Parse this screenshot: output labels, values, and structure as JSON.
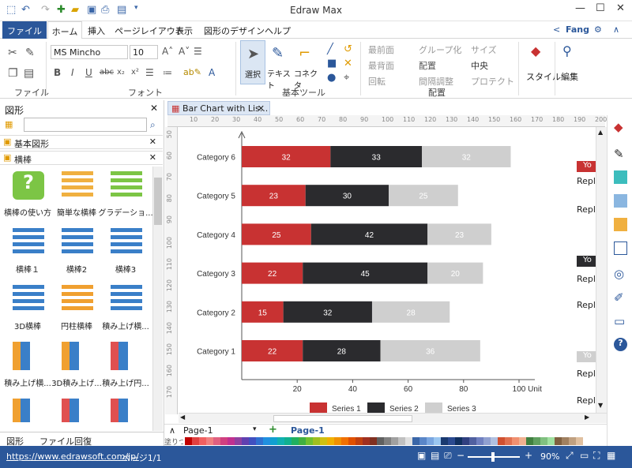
{
  "app_title": "Edraw Max",
  "user": "Fang",
  "tabs": [
    "ファイル",
    "ホーム",
    "挿入",
    "ページレイアウト",
    "表示",
    "図形のデザイン",
    "ヘルプ"
  ],
  "ribbon": {
    "font_name": "MS Mincho",
    "font_size": "10",
    "groups": {
      "file": "ファイル",
      "font": "フォント",
      "basic_tools": "基本ツール",
      "arrange": "配置"
    },
    "select": "選択",
    "text": "テキスト",
    "connector": "コネクタ",
    "front": "最前面",
    "back": "最背面",
    "rotate": "回転",
    "group": "グループ化",
    "align": "配置",
    "spacing": "間隔調整",
    "size": "サイズ",
    "center": "中央",
    "protect": "プロテクト",
    "style": "スタイル",
    "edit": "編集"
  },
  "left_panel": {
    "title": "図形",
    "library1": "基本図形",
    "library2": "横棒",
    "items": [
      "横棒の使い方",
      "簡単な横棒",
      "グラデーショ...",
      "横棒１",
      "横棒2",
      "横棒3",
      "3D横棒",
      "円柱横棒",
      "積み上げ横...",
      "積み上げ横...",
      "3D積み上げ...",
      "積み上げ円...",
      "",
      "",
      ""
    ],
    "tabs": [
      "図形",
      "ファイル回復"
    ]
  },
  "document_tab": "Bar Chart with Lis...",
  "ruler_h": [
    "10",
    "20",
    "30",
    "40",
    "50",
    "60",
    "70",
    "80",
    "90",
    "100",
    "110",
    "120",
    "130",
    "140",
    "150",
    "160",
    "170",
    "180",
    "190",
    "200"
  ],
  "ruler_v": [
    "50",
    "60",
    "70",
    "80",
    "90",
    "100",
    "110",
    "120",
    "130",
    "140",
    "150",
    "160",
    "170"
  ],
  "page_bar": {
    "page_selector": "Page-1",
    "active_page": "Page-1",
    "colors_label": "塗りつぶし"
  },
  "side_notes": {
    "badge1": "Yo",
    "badge2": "Yo",
    "badge3": "Yo",
    "reply": "Repl"
  },
  "chart_data": {
    "type": "bar",
    "orientation": "horizontal",
    "stacked": true,
    "categories": [
      "Category 1",
      "Category 2",
      "Category 3",
      "Category 4",
      "Category 5",
      "Category 6"
    ],
    "series": [
      {
        "name": "Series 1",
        "color": "#c83232",
        "values": [
          22,
          15,
          22,
          25,
          23,
          32
        ]
      },
      {
        "name": "Series 2",
        "color": "#2b2b2e",
        "values": [
          28,
          32,
          45,
          42,
          30,
          33
        ]
      },
      {
        "name": "Series 3",
        "color": "#cfcfcf",
        "values": [
          36,
          28,
          20,
          23,
          25,
          32
        ]
      }
    ],
    "xlim": [
      0,
      100
    ],
    "xticks": [
      "20",
      "40",
      "60",
      "80",
      "100"
    ],
    "xunit": "Unit",
    "legend_position": "bottom"
  },
  "status": {
    "url": "https://www.edrawsoft.com/jp/",
    "page_info": "ページ1/1",
    "zoom": "90%"
  }
}
